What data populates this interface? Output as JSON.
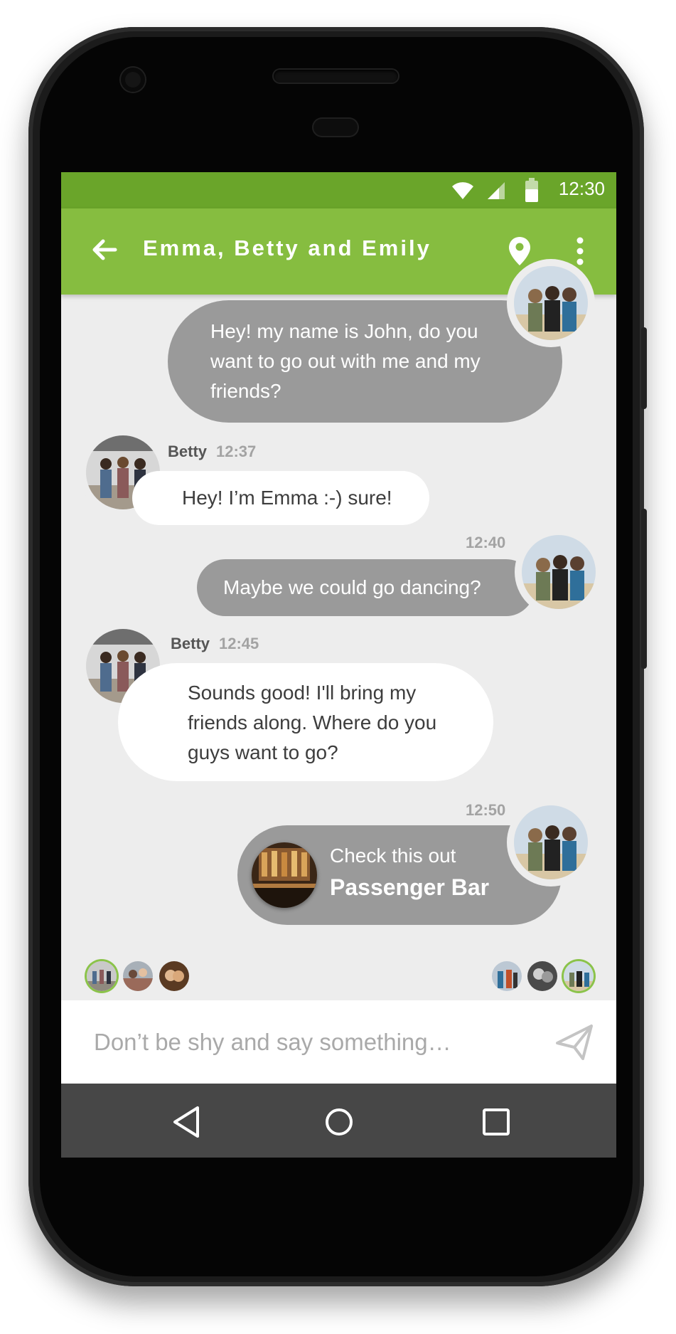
{
  "status_bar": {
    "time": "12:30"
  },
  "app_bar": {
    "title": "Emma, Betty and Emily"
  },
  "messages": [
    {
      "direction": "out",
      "time": "",
      "text": "Hey! my name is John, do you want to go out with me and my friends?"
    },
    {
      "direction": "in",
      "sender": "Betty",
      "time": "12:37",
      "text": "Hey! I’m Emma :-) sure!"
    },
    {
      "direction": "out",
      "time": "12:40",
      "text": "Maybe we could go dancing?"
    },
    {
      "direction": "in",
      "sender": "Betty",
      "time": "12:45",
      "text": "Sounds good! I'll bring my friends along. Where do you guys want to go?"
    },
    {
      "direction": "out",
      "time": "12:50",
      "card": {
        "prefix": "Check this out",
        "name": "Passenger Bar"
      }
    }
  ],
  "composer": {
    "placeholder": "Don’t be shy and say something…"
  },
  "colors": {
    "status_bar": "#6aa52a",
    "app_bar": "#86bd40",
    "outgoing_bubble": "#9a9a9a",
    "incoming_bubble": "#ffffff",
    "chat_background": "#ededed",
    "nav_bar": "#474747"
  },
  "icons": {
    "back": "arrow-left-icon",
    "location": "location-pin-icon",
    "more": "more-vertical-icon",
    "send": "send-icon",
    "nav": [
      "back-triangle-icon",
      "home-circle-icon",
      "recents-square-icon"
    ]
  }
}
